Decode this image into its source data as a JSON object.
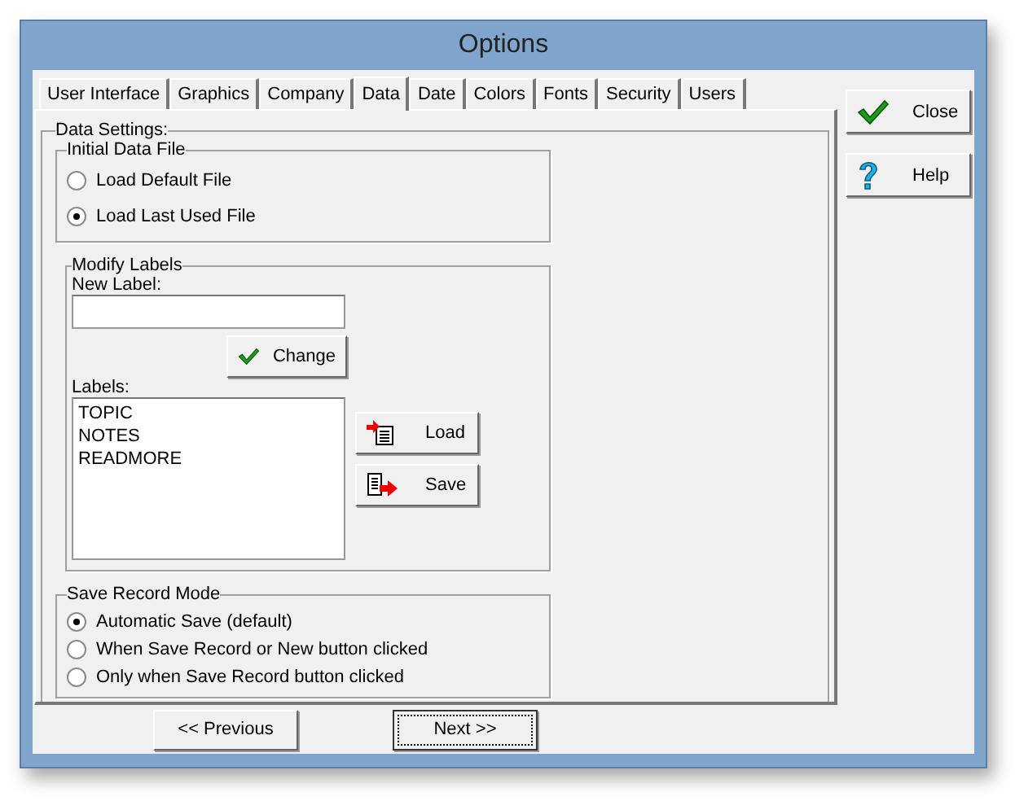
{
  "window": {
    "title": "Options"
  },
  "tabs": [
    {
      "label": "User Interface",
      "selected": false
    },
    {
      "label": "Graphics",
      "selected": false
    },
    {
      "label": "Company",
      "selected": false
    },
    {
      "label": "Data",
      "selected": true
    },
    {
      "label": "Date",
      "selected": false
    },
    {
      "label": "Colors",
      "selected": false
    },
    {
      "label": "Fonts",
      "selected": false
    },
    {
      "label": "Security",
      "selected": false
    },
    {
      "label": "Users",
      "selected": false
    }
  ],
  "data_settings": {
    "title": "Data Settings:",
    "initial_data_file": {
      "title": "Initial Data File",
      "options": [
        {
          "label": "Load Default File",
          "selected": false
        },
        {
          "label": "Load Last Used File",
          "selected": true
        }
      ]
    },
    "modify_labels": {
      "title": "Modify Labels",
      "new_label": {
        "label": "New Label:"
      },
      "change_button": "Change",
      "labels_caption": "Labels:",
      "labels": [
        "TOPIC",
        "NOTES",
        "READMORE"
      ],
      "load_button": "Load",
      "save_button": "Save"
    },
    "save_record_mode": {
      "title": "Save Record Mode",
      "options": [
        {
          "label": "Automatic Save (default)",
          "selected": true
        },
        {
          "label": "When Save Record or New button clicked",
          "selected": false
        },
        {
          "label": "Only when Save Record button clicked",
          "selected": false
        }
      ]
    }
  },
  "side_buttons": [
    {
      "kind": "close",
      "label": "Close"
    },
    {
      "kind": "help",
      "label": "Help"
    }
  ],
  "nav_buttons": [
    {
      "label": "<< Previous",
      "focused": false
    },
    {
      "label": "Next >>",
      "focused": true
    }
  ]
}
